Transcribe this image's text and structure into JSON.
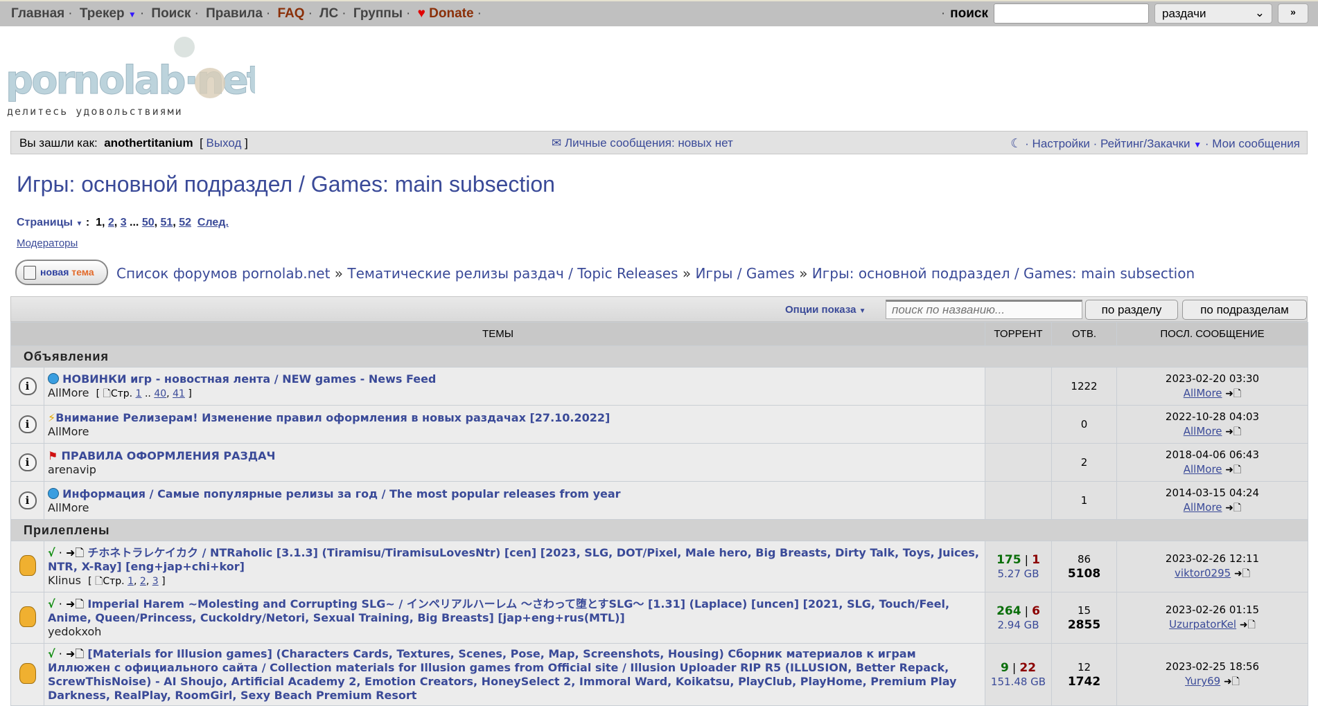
{
  "topnav": {
    "items": [
      "Главная",
      "Трекер",
      "Поиск",
      "Правила",
      "FAQ",
      "ЛС",
      "Группы",
      "Donate"
    ],
    "search_label": "поиск",
    "search_value": "",
    "search_type": "раздачи",
    "go": "»"
  },
  "logo": {
    "text": "pornolab·net",
    "tagline": "делитесь удовольствиями"
  },
  "userbar": {
    "logged_as": "Вы зашли как:",
    "username": "anothertitanium",
    "logout": "Выход",
    "messages": "Личные сообщения: новых нет",
    "settings": "Настройки",
    "rating": "Рейтинг/Закачки",
    "my_posts": "Мои сообщения"
  },
  "title": "Игры: основной подраздел / Games: main subsection",
  "pagination": {
    "label": "Страницы",
    "current": "1",
    "pages": [
      "2",
      "3",
      "50",
      "51",
      "52"
    ],
    "next": "След."
  },
  "moderators": "Модераторы",
  "new_topic": {
    "a": "новая",
    "b": "тема"
  },
  "breadcrumbs": [
    "Список форумов pornolab.net",
    "Тематические релизы раздач / Topic Releases",
    "Игры / Games",
    "Игры: основной подраздел / Games: main subsection"
  ],
  "options": {
    "label": "Опции показа",
    "search_placeholder": "поиск по названию...",
    "by_section": "по разделу",
    "by_subsections": "по подразделам"
  },
  "columns": [
    "ТЕМЫ",
    "ТОРРЕНТ",
    "ОТВ.",
    "ПОСЛ. СООБЩЕНИЕ"
  ],
  "announcements": {
    "label": "Объявления",
    "rows": [
      {
        "icon": "globe",
        "title": "НОВИНКИ игр - новостная лента / NEW games - News Feed",
        "author": "AllMore",
        "pages_label": "Стр.",
        "pages": [
          "1",
          "40",
          "41"
        ],
        "replies": "1222",
        "last_date": "2023-02-20 03:30",
        "last_user": "AllMore"
      },
      {
        "icon": "lightning",
        "title": "Внимание Релизерам! Изменение правил оформления в новых раздачах [27.10.2022]",
        "author": "AllMore",
        "replies": "0",
        "last_date": "2022-10-28 04:03",
        "last_user": "AllMore"
      },
      {
        "icon": "flag",
        "title": "ПРАВИЛА ОФОРМЛЕНИЯ РАЗДАЧ",
        "author": "arenavip",
        "replies": "2",
        "last_date": "2018-04-06 06:43",
        "last_user": "AllMore"
      },
      {
        "icon": "globe",
        "title": "Информация / Самые популярные релизы за год / The most popular releases from year",
        "author": "AllMore",
        "replies": "1",
        "last_date": "2014-03-15 04:24",
        "last_user": "AllMore"
      }
    ]
  },
  "sticky": {
    "label": "Прилеплены",
    "rows": [
      {
        "title": "チホネトラレケイカク / NTRaholic [3.1.3] (Tiramisu/TiramisuLovesNtr) [cen] [2023, SLG, DOT/Pixel, Male hero, Big Breasts, Dirty Talk, Toys, Juices, NTR, X-Ray] [eng+jap+chi+kor]",
        "author": "Klinus",
        "pages_label": "Стр.",
        "pages": [
          "1",
          "2",
          "3"
        ],
        "seeds": "175",
        "leechs": "1",
        "size": "5.27 GB",
        "replies": "86",
        "downloads": "5108",
        "last_date": "2023-02-26 12:11",
        "last_user": "viktor0295"
      },
      {
        "title": "Imperial Harem ~Molesting and Corrupting SLG~ / インペリアルハーレム ～さわって堕とすSLG～ [1.31] (Laplace) [uncen] [2021, SLG, Touch/Feel, Anime, Queen/Princess, Cuckoldry/Netori, Sexual Training, Big Breasts] [jap+eng+rus(MTL)]",
        "author": "yedokxoh",
        "seeds": "264",
        "leechs": "6",
        "size": "2.94 GB",
        "replies": "15",
        "downloads": "2855",
        "last_date": "2023-02-26 01:15",
        "last_user": "UzurpatorKel"
      },
      {
        "title": "[Materials for Illusion games] (Characters Cards, Textures, Scenes, Pose, Map, Screenshots, Housing) Сборник материалов к играм Иллюжен с официального сайта / Collection materials for Illusion games from Official site / Illusion Uploader RIP R5 (ILLUSION, Better Repack, ScrewThisNoise) - AI Shoujo, Artificial Academy 2, Emotion Creators, HoneySelect 2, Immoral Ward, Koikatsu, PlayClub, PlayHome, Premium Play Darkness, RealPlay, RoomGirl, Sexy Beach Premium Resort",
        "seeds": "9",
        "leechs": "22",
        "size": "151.48 GB",
        "replies": "12",
        "downloads": "1742",
        "last_date": "2023-02-25 18:56",
        "last_user": "Yury69"
      }
    ]
  },
  "colors": {
    "link": "#3a4a98",
    "seed": "#0a6e0a",
    "leech": "#8b0000",
    "faq": "#8a2f08"
  }
}
